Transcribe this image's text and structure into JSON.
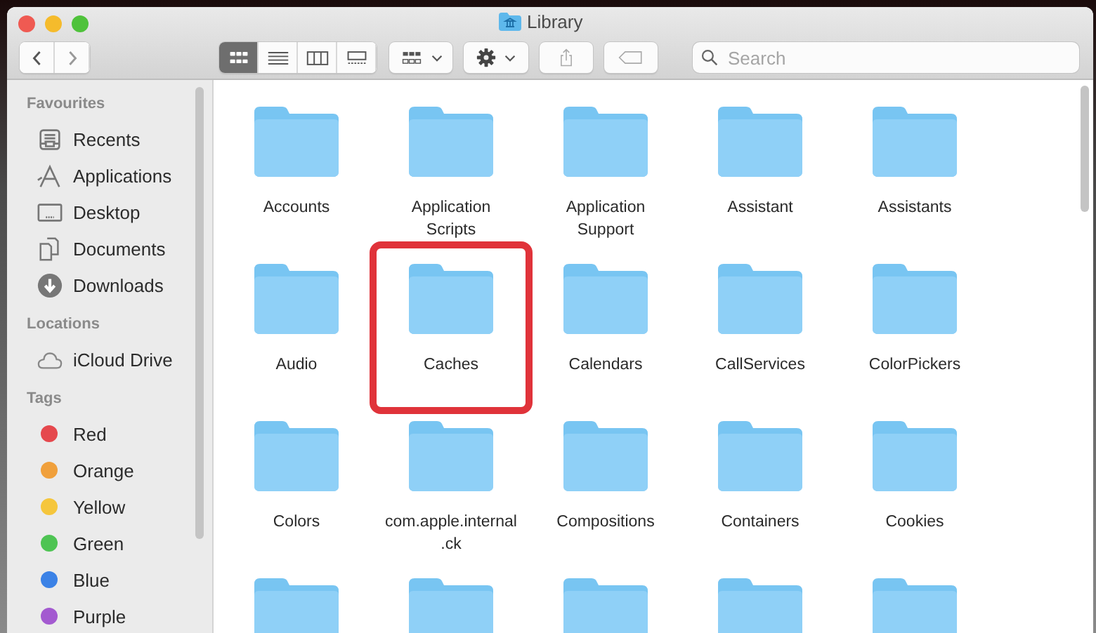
{
  "window": {
    "title": "Library"
  },
  "toolbar": {
    "views": [
      {
        "kind": "icons",
        "selected": true
      },
      {
        "kind": "list",
        "selected": false
      },
      {
        "kind": "columns",
        "selected": false
      },
      {
        "kind": "gallery",
        "selected": false
      }
    ]
  },
  "search": {
    "placeholder": "Search"
  },
  "sidebar": {
    "sections": [
      {
        "title": "Favourites",
        "items": [
          {
            "label": "Recents",
            "kind": "recents"
          },
          {
            "label": "Applications",
            "kind": "applications"
          },
          {
            "label": "Desktop",
            "kind": "desktop"
          },
          {
            "label": "Documents",
            "kind": "documents"
          },
          {
            "label": "Downloads",
            "kind": "downloads"
          }
        ]
      },
      {
        "title": "Locations",
        "items": [
          {
            "label": "iCloud Drive",
            "kind": "cloud"
          }
        ]
      },
      {
        "title": "Tags",
        "items": [
          {
            "label": "Red",
            "kind": "tag",
            "color": "#e5484d"
          },
          {
            "label": "Orange",
            "kind": "tag",
            "color": "#f0a03c"
          },
          {
            "label": "Yellow",
            "kind": "tag",
            "color": "#f5c63c"
          },
          {
            "label": "Green",
            "kind": "tag",
            "color": "#4ec453"
          },
          {
            "label": "Blue",
            "kind": "tag",
            "color": "#3b82e6"
          },
          {
            "label": "Purple",
            "kind": "tag",
            "color": "#a35ad0"
          }
        ]
      }
    ]
  },
  "folders": [
    {
      "label": "Accounts",
      "highlighted": false
    },
    {
      "label": "Application Scripts",
      "highlighted": false
    },
    {
      "label": "Application Support",
      "highlighted": false
    },
    {
      "label": "Assistant",
      "highlighted": false
    },
    {
      "label": "Assistants",
      "highlighted": false
    },
    {
      "label": "Audio",
      "highlighted": false
    },
    {
      "label": "Caches",
      "highlighted": true
    },
    {
      "label": "Calendars",
      "highlighted": false
    },
    {
      "label": "CallServices",
      "highlighted": false
    },
    {
      "label": "ColorPickers",
      "highlighted": false
    },
    {
      "label": "Colors",
      "highlighted": false
    },
    {
      "label": "com.apple.internal.ck",
      "highlighted": false
    },
    {
      "label": "Compositions",
      "highlighted": false
    },
    {
      "label": "Containers",
      "highlighted": false
    },
    {
      "label": "Cookies",
      "highlighted": false
    },
    {
      "highlighted": false
    },
    {
      "highlighted": false
    },
    {
      "highlighted": false
    },
    {
      "highlighted": false
    },
    {
      "highlighted": false
    }
  ]
}
